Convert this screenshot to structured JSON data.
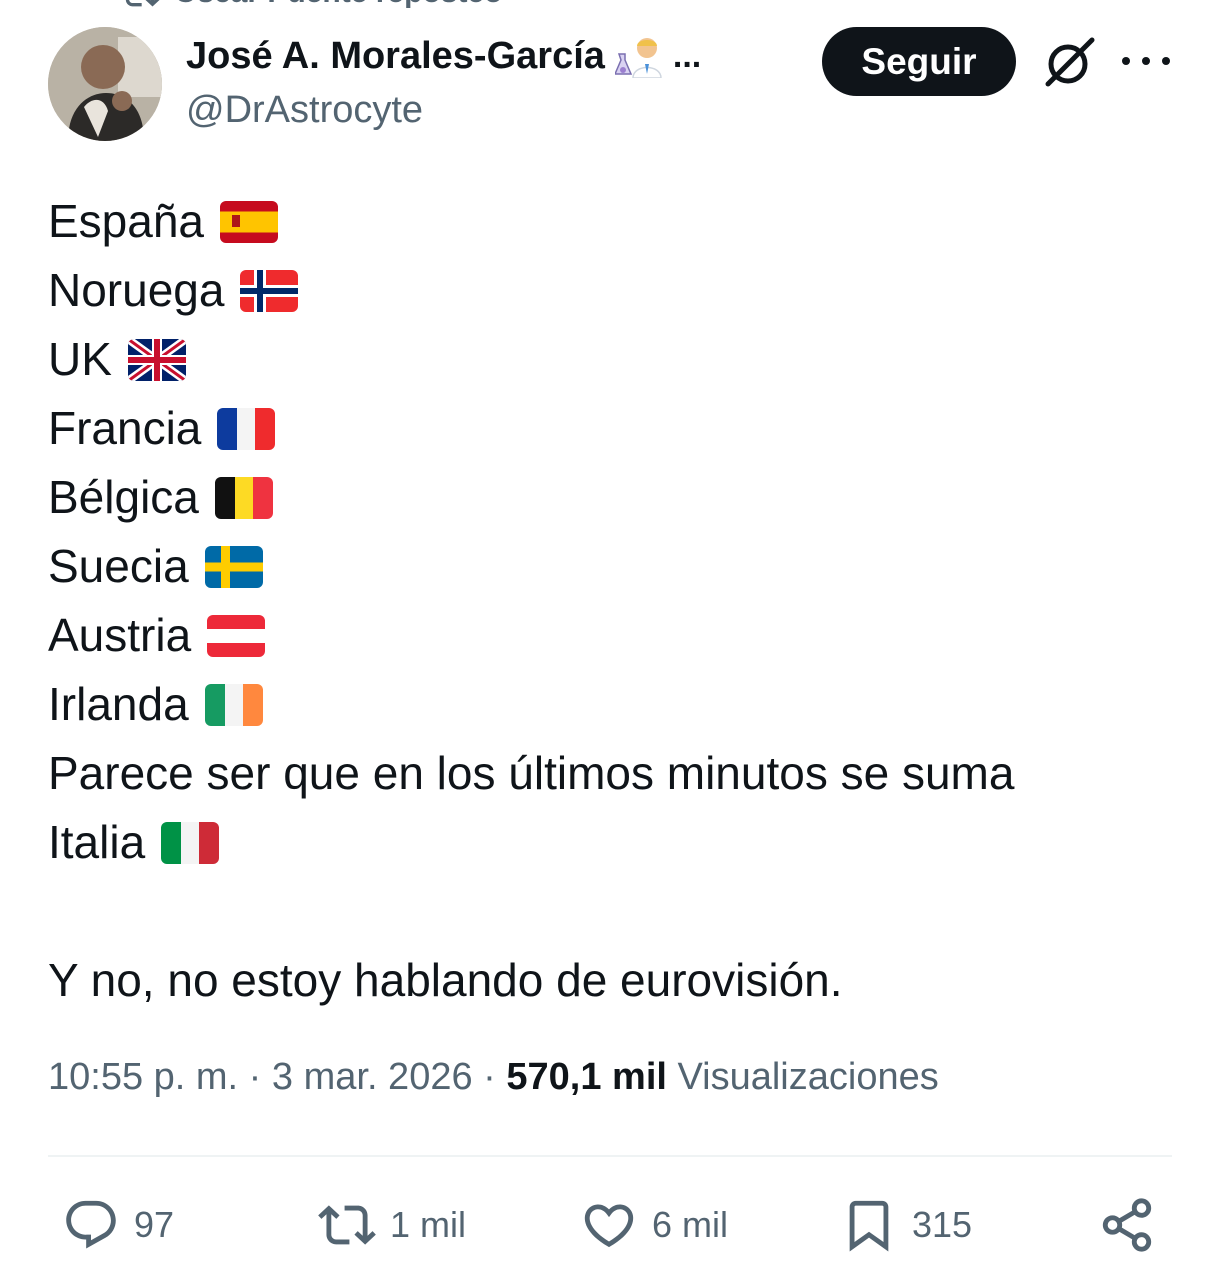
{
  "repost": {
    "text": "Oscar Puente reposteó"
  },
  "author": {
    "name": "José A. Morales-García",
    "ellipsis": "...",
    "handle": "@DrAstrocyte"
  },
  "follow_label": "Seguir",
  "tweet": {
    "countries": [
      {
        "label": "España",
        "flag": "spain-flag"
      },
      {
        "label": "Noruega",
        "flag": "norway-flag"
      },
      {
        "label": "UK",
        "flag": "uk-flag"
      },
      {
        "label": "Francia",
        "flag": "france-flag"
      },
      {
        "label": "Bélgica",
        "flag": "belgium-flag"
      },
      {
        "label": "Suecia",
        "flag": "sweden-flag"
      },
      {
        "label": "Austria",
        "flag": "austria-flag"
      },
      {
        "label": "Irlanda",
        "flag": "ireland-flag"
      }
    ],
    "note": "Parece ser que en los últimos minutos se suma",
    "last_country": {
      "label": "Italia",
      "flag": "italy-flag"
    },
    "closing": "Y no, no estoy hablando de eurovisión."
  },
  "meta": {
    "time": "10:55 p. m.",
    "sep1": " · ",
    "date": "3 mar. 2026",
    "sep2": " · ",
    "views_count": "570,1 mil",
    "views_label": " Visualizaciones"
  },
  "actions": {
    "replies": "97",
    "reposts": "1 mil",
    "likes": "6 mil",
    "bookmarks": "315"
  },
  "colors": {
    "text": "#0f1419",
    "secondary": "#536471",
    "divider": "#eff3f4"
  }
}
